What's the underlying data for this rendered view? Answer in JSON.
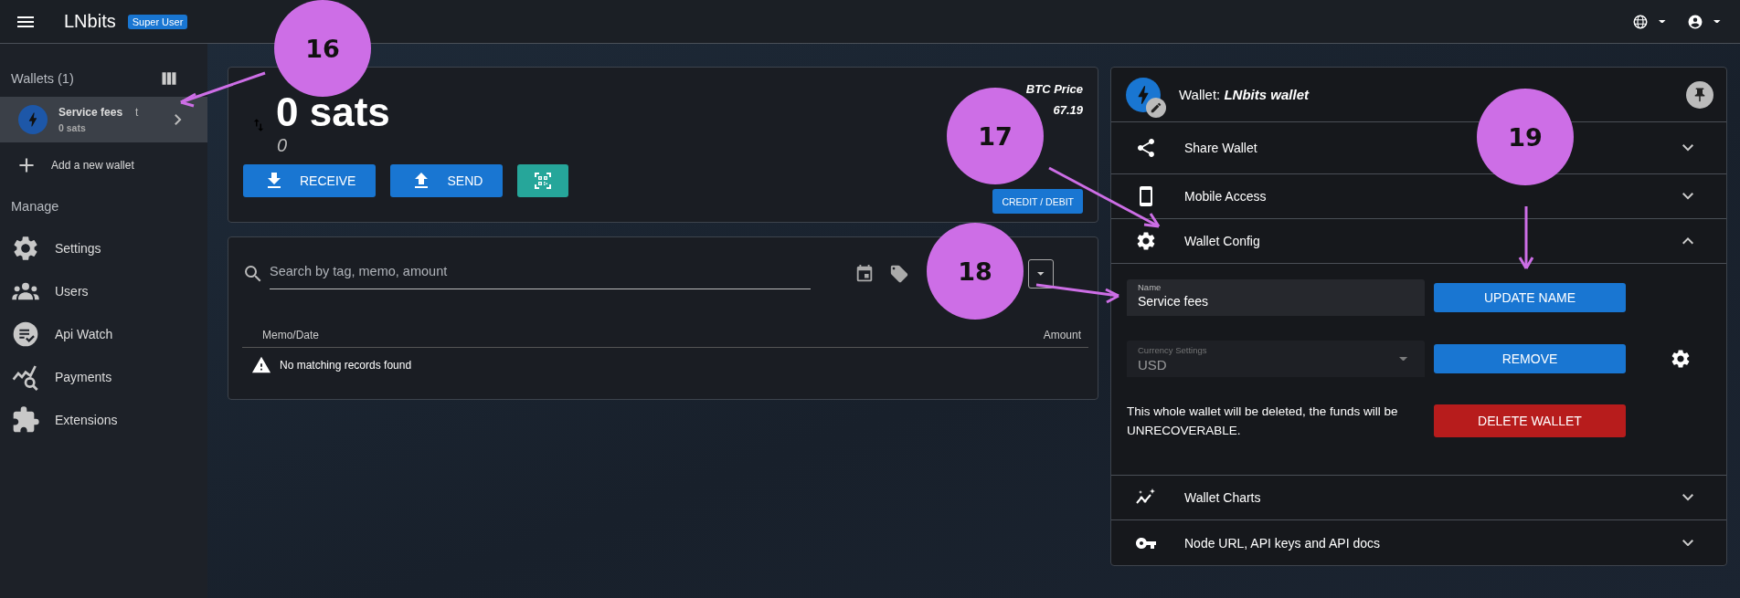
{
  "header": {
    "title": "LNbits",
    "badge": "Super User"
  },
  "sidebar": {
    "wallets_heading": "Wallets (1)",
    "wallets": [
      {
        "name": "Service fees",
        "mark": "t",
        "balance": "0 sats",
        "selected": true
      }
    ],
    "add_wallet": "Add a new wallet",
    "manage_heading": "Manage",
    "items": [
      {
        "label": "Settings"
      },
      {
        "label": "Users"
      },
      {
        "label": "Api Watch"
      },
      {
        "label": "Payments"
      },
      {
        "label": "Extensions"
      }
    ]
  },
  "balance_card": {
    "amount": "0 sats",
    "fiat": "0",
    "buttons": [
      {
        "label": "RECEIVE",
        "kind": "receive"
      },
      {
        "label": "SEND",
        "kind": "send"
      },
      {
        "kind": "scan"
      }
    ],
    "price_label": "BTC Price",
    "price": "67.19",
    "credit_button": "CREDIT / DEBIT"
  },
  "payments": {
    "search": {
      "placeholder": "Search by tag, memo, amount"
    },
    "columns": [
      "Memo/Date",
      "Amount"
    ],
    "empty_message": "No matching records found"
  },
  "wallet_panel": {
    "title": "Wallet: **LNbits wallet**",
    "sections": [
      {
        "label": "Share Wallet",
        "expanded": false
      },
      {
        "label": "Mobile Access",
        "expanded": false
      },
      {
        "label": "Wallet Config",
        "expanded": true
      },
      {
        "label": "Wallet Charts",
        "expanded": false
      },
      {
        "label": "Node URL, API keys and API docs",
        "expanded": false
      }
    ],
    "config": {
      "name_field": {
        "label": "Name",
        "value": "Service fees"
      },
      "update_button": "UPDATE NAME",
      "currency_field": {
        "label": "Currency Settings",
        "value": "USD",
        "disabled": true
      },
      "remove_button": "REMOVE",
      "delete_warning": "This whole wallet will be deleted, the funds will be UNRECOVERABLE.",
      "delete_button": "DELETE WALLET"
    }
  },
  "callouts": [
    {
      "label": "16"
    },
    {
      "label": "17"
    },
    {
      "label": "18"
    },
    {
      "label": "19"
    }
  ]
}
